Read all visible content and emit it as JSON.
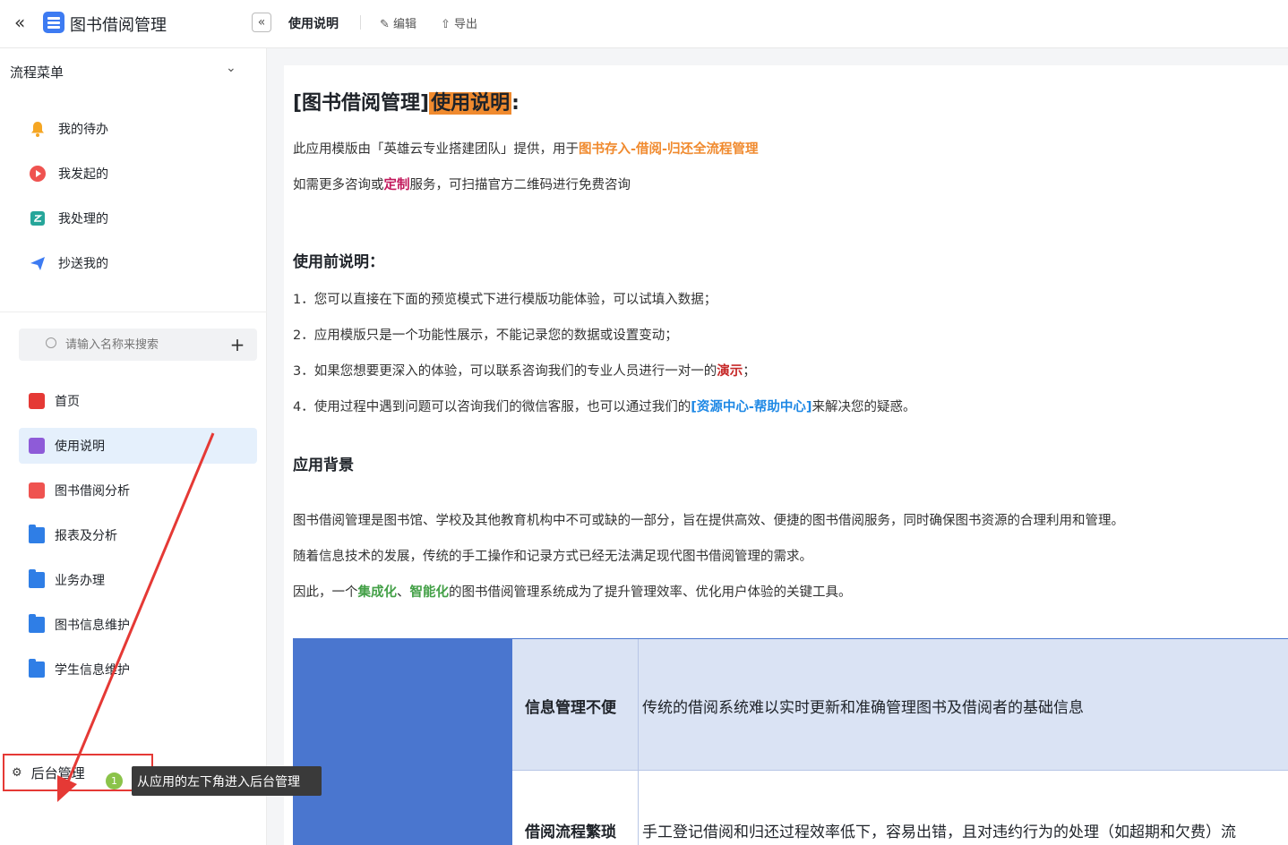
{
  "header": {
    "app_title": "图书借阅管理",
    "tab_doc": "使用说明",
    "edit_label": "编辑",
    "export_label": "导出"
  },
  "sidebar": {
    "flow_menu_title": "流程菜单",
    "flow_items": [
      {
        "label": "我的待办",
        "icon": "bell-icon"
      },
      {
        "label": "我发起的",
        "icon": "play-icon"
      },
      {
        "label": "我处理的",
        "icon": "check-icon"
      },
      {
        "label": "抄送我的",
        "icon": "send-icon"
      }
    ],
    "search_placeholder": "请输入名称来搜索",
    "nav_items": [
      {
        "label": "首页",
        "icon": "home-icon"
      },
      {
        "label": "使用说明",
        "icon": "chart-icon",
        "active": true
      },
      {
        "label": "图书借阅分析",
        "icon": "chart-icon"
      },
      {
        "label": "报表及分析",
        "icon": "folder-icon"
      },
      {
        "label": "业务办理",
        "icon": "folder-icon"
      },
      {
        "label": "图书信息维护",
        "icon": "folder-icon"
      },
      {
        "label": "学生信息维护",
        "icon": "folder-icon"
      }
    ],
    "admin_label": "后台管理"
  },
  "tooltip": {
    "step": "1",
    "text": "从应用的左下角进入后台管理"
  },
  "content": {
    "title_prefix": "[图书借阅管理]",
    "title_highlight": "使用说明",
    "title_suffix": ":",
    "intro1_a": "此应用模版由「英雄云专业搭建团队」提供，用于",
    "intro1_b": "图书存入-借阅-归还全流程管理",
    "intro2_a": "如需更多咨询或",
    "intro2_b": "定制",
    "intro2_c": "服务，可扫描官方二维码进行免费咨询",
    "pre_title": "使用前说明：",
    "pre1": "1．您可以直接在下面的预览模式下进行模版功能体验，可以试填入数据；",
    "pre2": "2．应用模版只是一个功能性展示，不能记录您的数据或设置变动；",
    "pre3_a": "3．如果您想要更深入的体验，可以联系咨询我们的专业人员进行一对一的",
    "pre3_b": "演示",
    "pre3_c": "；",
    "pre4_a": "4．使用过程中遇到问题可以咨询我们的微信客服，也可以通过我们的",
    "pre4_b": "[资源中心-帮助中心]",
    "pre4_c": "来解决您的疑惑。",
    "bg_title": "应用背景",
    "bg1": "图书借阅管理是图书馆、学校及其他教育机构中不可或缺的一部分，旨在提供高效、便捷的图书借阅服务，同时确保图书资源的合理利用和管理。",
    "bg2": "随着信息技术的发展，传统的手工操作和记录方式已经无法满足现代图书借阅管理的需求。",
    "bg3_a": "因此，一个",
    "bg3_b": "集成化",
    "bg3_c": "、",
    "bg3_d": "智能化",
    "bg3_e": "的图书借阅管理系统成为了提升管理效率、优化用户体验的关键工具。",
    "table": [
      {
        "key": "信息管理不便",
        "value": "传统的借阅系统难以实时更新和准确管理图书及借阅者的基础信息"
      },
      {
        "key": "借阅流程繁琐",
        "value": "手工登记借阅和归还过程效率低下，容易出错，且对违约行为的处理（如超期和欠费）流"
      }
    ]
  }
}
